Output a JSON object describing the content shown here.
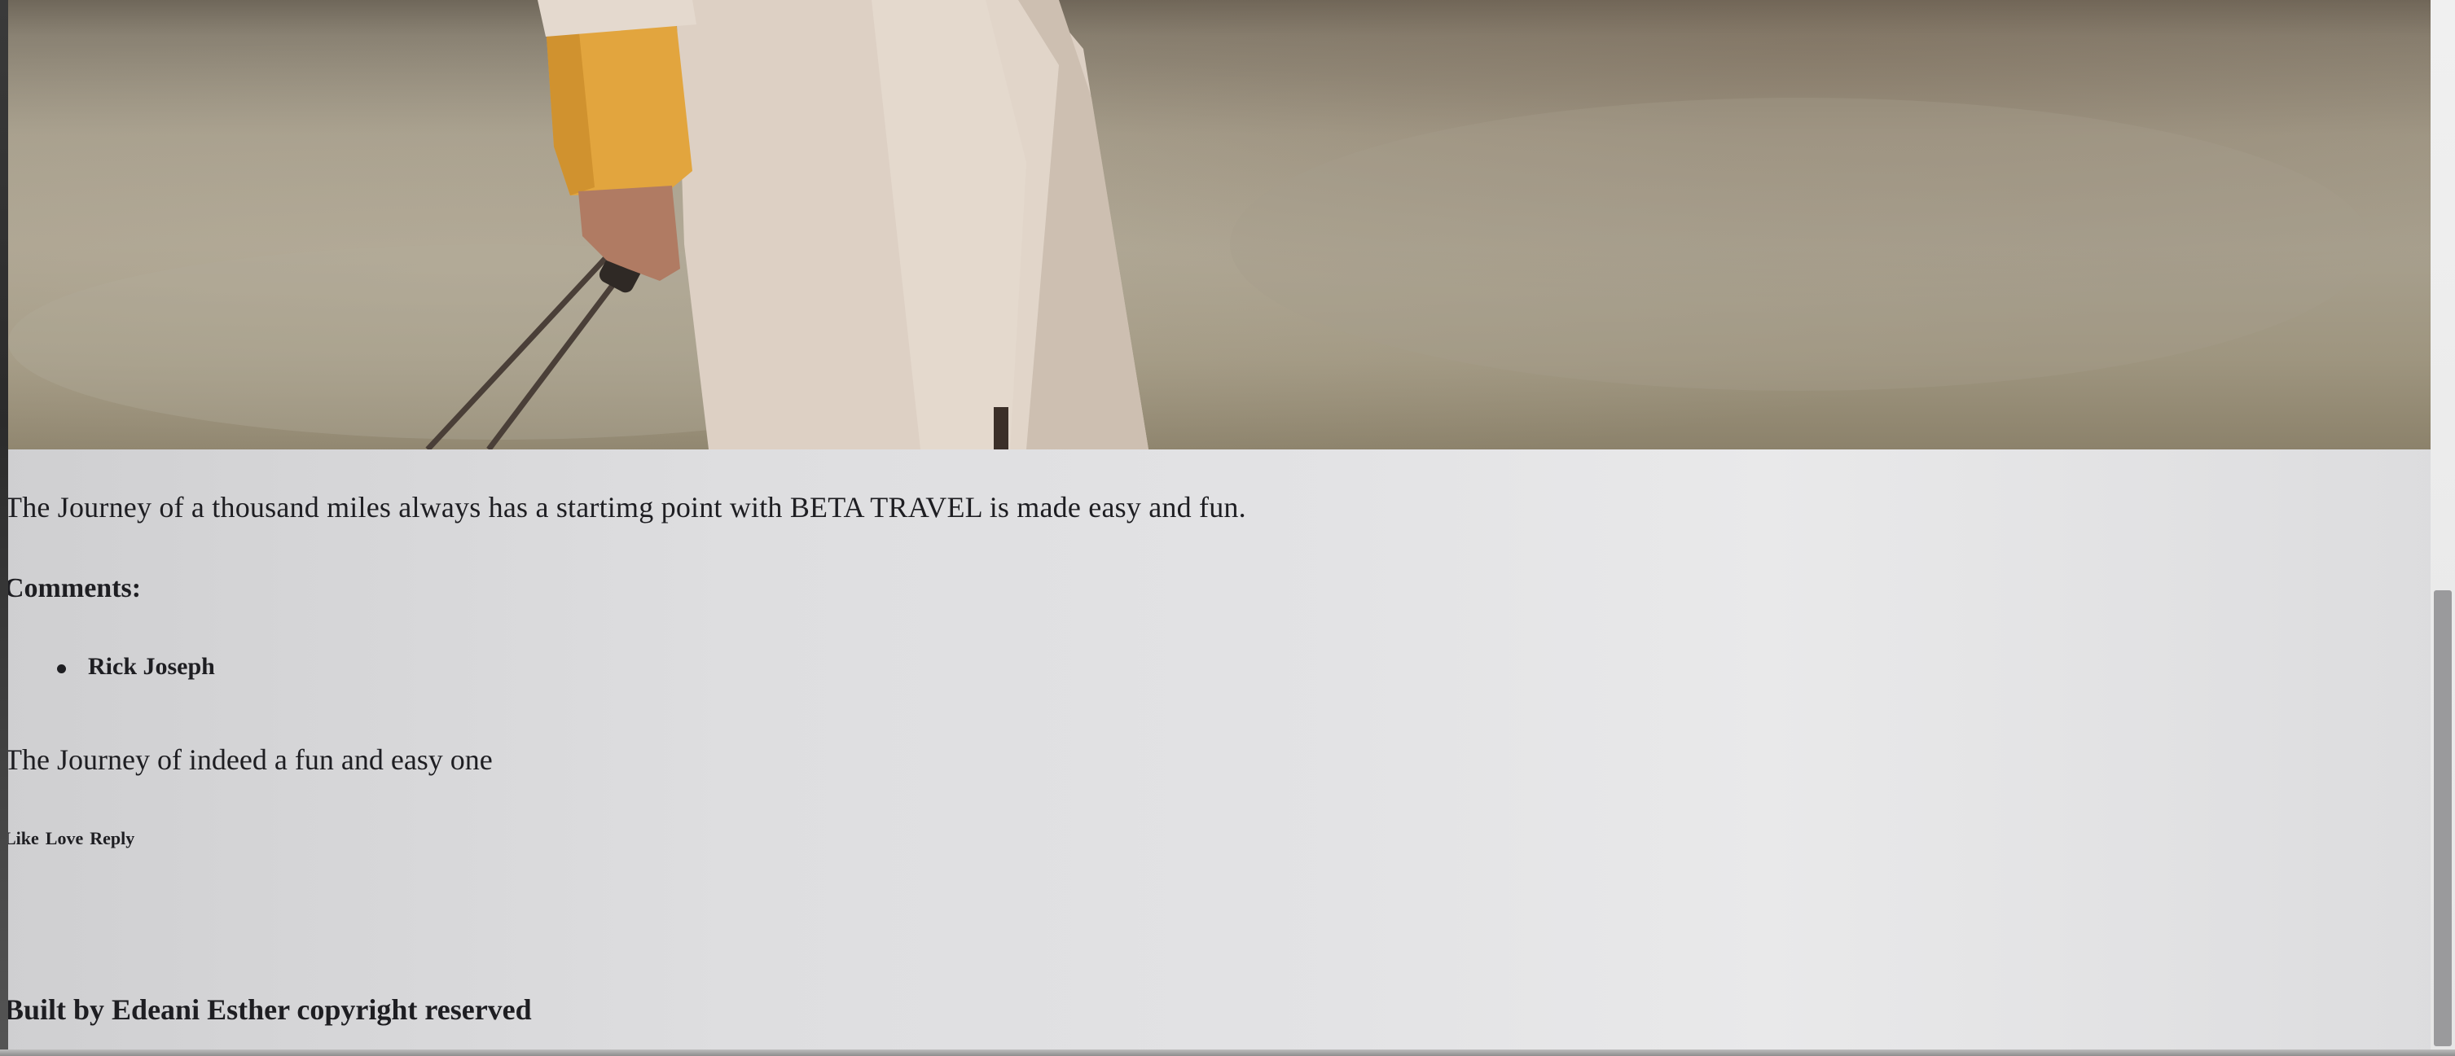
{
  "post": {
    "intro_text": "The Journey of a thousand miles always has a startimg point with BETA TRAVEL is made easy and fun."
  },
  "comments": {
    "heading": "Comments:",
    "items": [
      {
        "author": "Rick Joseph",
        "text": "The Journey of indeed a fun and easy one",
        "actions": [
          "Like",
          "Love",
          "Reply"
        ]
      }
    ]
  },
  "footer": {
    "credit": "Built by Edeani Esther copyright reserved"
  }
}
